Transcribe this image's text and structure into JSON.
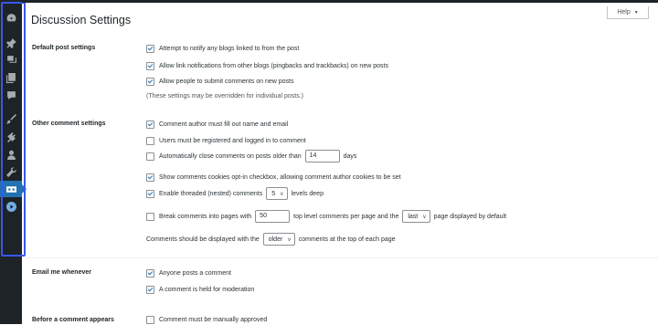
{
  "help_button": {
    "label": "Help",
    "arrow": "▼"
  },
  "page_title": "Discussion Settings",
  "sidebar": {
    "icons": [
      "dashboard-icon",
      "pin-icon",
      "media-icon",
      "pages-icon",
      "comments-icon",
      "appearance-icon",
      "plugins-icon",
      "users-icon",
      "tools-icon",
      "settings-icon",
      "play-icon"
    ],
    "active_index": 9
  },
  "sections": {
    "default_post": {
      "label": "Default post settings",
      "items": [
        {
          "label": "Attempt to notify any blogs linked to from the post",
          "checked": true
        },
        {
          "label": "Allow link notifications from other blogs (pingbacks and trackbacks) on new posts",
          "checked": true
        },
        {
          "label": "Allow people to submit comments on new posts",
          "checked": true
        }
      ],
      "note": "(These settings may be overridden for individual posts.)"
    },
    "other_comment": {
      "label": "Other comment settings",
      "items": [
        {
          "label": "Comment author must fill out name and email",
          "checked": true
        },
        {
          "label": "Users must be registered and logged in to comment",
          "checked": false
        }
      ],
      "auto_close": {
        "prefix": "Automatically close comments on posts older than",
        "value": "14",
        "suffix": "days",
        "checked": false
      },
      "cookies": {
        "label": "Show comments cookies opt-in checkbox, allowing comment author cookies to be set",
        "checked": true
      },
      "threaded": {
        "prefix": "Enable threaded (nested) comments",
        "value": "5",
        "suffix": "levels deep",
        "checked": true
      },
      "paging": {
        "prefix": "Break comments into pages with",
        "value": "50",
        "middle": "top level comments per page and the",
        "select": "last",
        "suffix": "page displayed by default",
        "checked": false
      },
      "order": {
        "prefix": "Comments should be displayed with the",
        "select": "older",
        "suffix": "comments at the top of each page"
      }
    },
    "email_me": {
      "label": "Email me whenever",
      "items": [
        {
          "label": "Anyone posts a comment",
          "checked": true
        },
        {
          "label": "A comment is held for moderation",
          "checked": true
        }
      ]
    },
    "before_appears": {
      "label": "Before a comment appears",
      "items": [
        {
          "label": "Comment must be manually approved",
          "checked": false
        }
      ]
    }
  }
}
